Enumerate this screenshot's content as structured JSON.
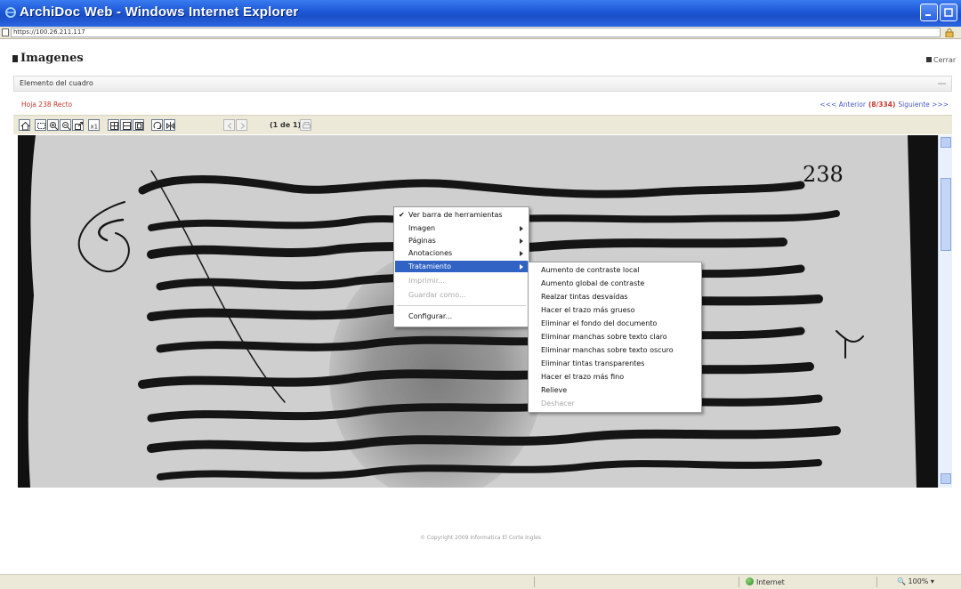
{
  "window": {
    "title": "ArchiDoc Web - Windows Internet Explorer"
  },
  "address": {
    "url": "https://100.26.211.117",
    "url_suffix": ""
  },
  "page": {
    "title": "Imagenes",
    "close_label": "Cerrar",
    "section_label": "Elemento del cuadro",
    "folio": "Hoja 238 Recto",
    "prev_label": "<<< Anterior",
    "page_count": "(8/334)",
    "next_label": "Siguiente >>>",
    "page_indicator": "(1 de 1)",
    "copyright": "© Copyright 2009 Informatica El Corte Ingles"
  },
  "document": {
    "page_number": "238"
  },
  "context_menu": {
    "items": [
      {
        "label": "Ver barra de herramientas",
        "checked": true,
        "submenu": false,
        "disabled": false,
        "active": false
      },
      {
        "label": "Imagen",
        "checked": false,
        "submenu": true,
        "disabled": false,
        "active": false
      },
      {
        "label": "Páginas",
        "checked": false,
        "submenu": true,
        "disabled": false,
        "active": false
      },
      {
        "label": "Anotaciones",
        "checked": false,
        "submenu": true,
        "disabled": false,
        "active": false
      },
      {
        "label": "Tratamiento",
        "checked": false,
        "submenu": true,
        "disabled": false,
        "active": true
      },
      {
        "label": "Imprimir...",
        "checked": false,
        "submenu": false,
        "disabled": true,
        "active": false
      },
      {
        "label": "Guardar como...",
        "checked": false,
        "submenu": false,
        "disabled": true,
        "active": false
      },
      {
        "label": "Configurar...",
        "checked": false,
        "submenu": false,
        "disabled": false,
        "active": false
      }
    ]
  },
  "submenu": {
    "items": [
      {
        "label": "Aumento de contraste local",
        "disabled": false
      },
      {
        "label": "Aumento global de contraste",
        "disabled": false
      },
      {
        "label": "Realzar tintas desvaídas",
        "disabled": false
      },
      {
        "label": "Hacer el trazo más grueso",
        "disabled": false
      },
      {
        "label": "Eliminar el fondo del documento",
        "disabled": false
      },
      {
        "label": "Eliminar manchas sobre texto claro",
        "disabled": false
      },
      {
        "label": "Eliminar manchas sobre texto oscuro",
        "disabled": false
      },
      {
        "label": "Eliminar tintas transparentes",
        "disabled": false
      },
      {
        "label": "Hacer el trazo más fino",
        "disabled": false
      },
      {
        "label": "Relieve",
        "disabled": false
      },
      {
        "label": "Deshacer",
        "disabled": true
      }
    ]
  },
  "status": {
    "zone": "Internet",
    "zoom": "100%"
  },
  "colors": {
    "titlebar": "#1f5ad8",
    "menu_highlight": "#3163c5",
    "folio_text": "#c0392b",
    "pager_link": "#4a5ac8"
  }
}
